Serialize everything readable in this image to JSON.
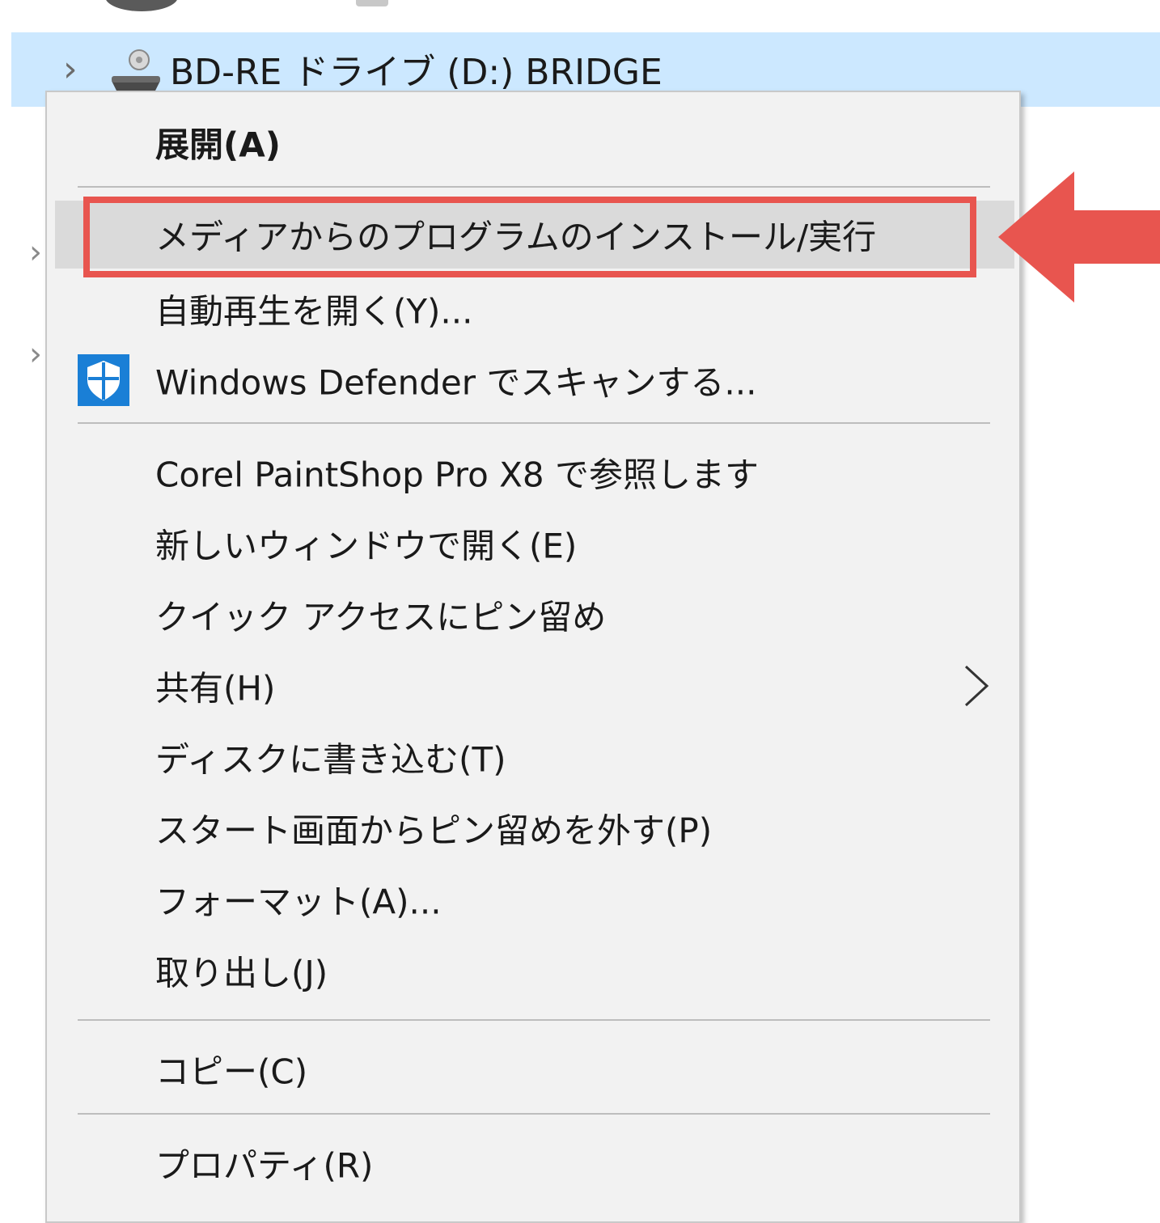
{
  "tree": {
    "drive_label": "BD-RE ドライブ (D:) BRIDGE"
  },
  "menu": {
    "items": [
      {
        "label": "展開(A)"
      },
      {
        "label": "メディアからのプログラムのインストール/実行"
      },
      {
        "label": "自動再生を開く(Y)..."
      },
      {
        "label": "Windows Defender でスキャンする..."
      },
      {
        "label": "Corel PaintShop Pro X8 で参照します"
      },
      {
        "label": "新しいウィンドウで開く(E)"
      },
      {
        "label": "クイック アクセスにピン留め"
      },
      {
        "label": "共有(H)"
      },
      {
        "label": "ディスクに書き込む(T)"
      },
      {
        "label": "スタート画面からピン留めを外す(P)"
      },
      {
        "label": "フォーマット(A)..."
      },
      {
        "label": "取り出し(J)"
      },
      {
        "label": "コピー(C)"
      },
      {
        "label": "プロパティ(R)"
      }
    ]
  },
  "colors": {
    "selection_row": "#cce8ff",
    "menu_background": "#f2f2f2",
    "hover_highlight": "#dadada",
    "annotation_red": "#e8554f",
    "defender_blue": "#1a7fd6"
  },
  "icons": {
    "drive": "optical-drive-icon",
    "defender": "windows-defender-shield-icon",
    "submenu": "chevron-right-icon",
    "expand": "chevron-right-icon"
  }
}
